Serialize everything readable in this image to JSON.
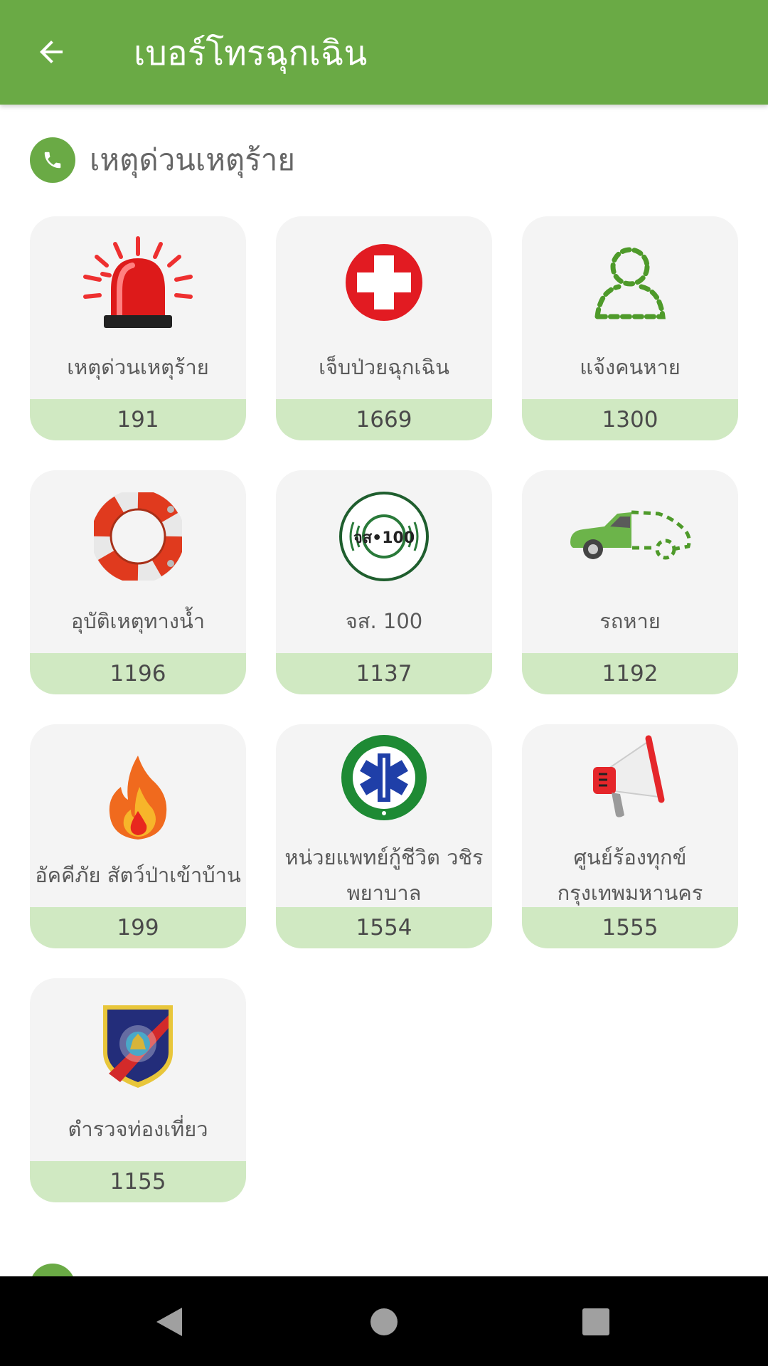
{
  "appbar": {
    "title": "เบอร์โทรฉุกเฉิน"
  },
  "section": {
    "title": "เหตุด่วนเหตุร้าย"
  },
  "cards": [
    {
      "label": "เหตุด่วนเหตุร้าย",
      "number": "191",
      "icon": "siren-icon"
    },
    {
      "label": "เจ็บป่วยฉุกเฉิน",
      "number": "1669",
      "icon": "medical-cross-icon"
    },
    {
      "label": "แจ้งคนหาย",
      "number": "1300",
      "icon": "missing-person-icon"
    },
    {
      "label": "อุบัติเหตุทางน้ำ",
      "number": "1196",
      "icon": "lifebuoy-icon"
    },
    {
      "label": "จส. 100",
      "number": "1137",
      "icon": "js100-logo-icon",
      "logo_text": "จส•100"
    },
    {
      "label": "รถหาย",
      "number": "1192",
      "icon": "missing-car-icon"
    },
    {
      "label": "อัคคีภัย สัตว์ป่าเข้าบ้าน",
      "number": "199",
      "icon": "fire-icon"
    },
    {
      "label": "หน่วยแพทย์กู้ชีวิต วชิรพยาบาล",
      "number": "1554",
      "icon": "vajira-ems-logo-icon"
    },
    {
      "label": "ศูนย์ร้องทุกข์กรุงเทพมหานคร",
      "number": "1555",
      "icon": "megaphone-icon"
    },
    {
      "label": "ตำรวจท่องเที่ยว",
      "number": "1155",
      "icon": "tourist-police-badge-icon"
    }
  ],
  "colors": {
    "primary": "#6aaa45",
    "card_bg": "#f4f4f4",
    "number_bg": "#d0e9c2"
  }
}
